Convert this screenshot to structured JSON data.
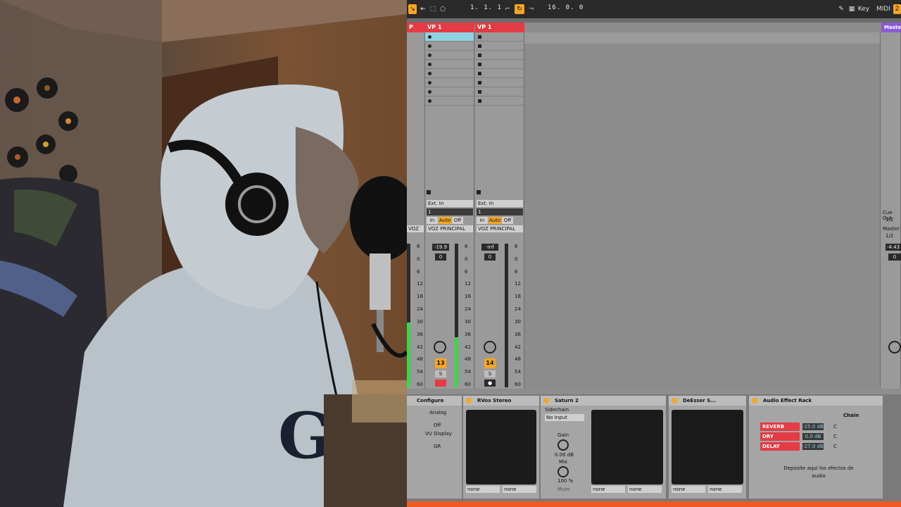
{
  "transport": {
    "position": "1.   1.   1",
    "end_position": "16.   0.   0",
    "key_label": "Key",
    "midi_label": "MIDI"
  },
  "tracks": [
    {
      "name": "VP 1",
      "input_type": "Ext. In",
      "input_channel": "1",
      "monitor": [
        "In",
        "Auto",
        "Off"
      ],
      "output": "VOZ PRINCIPAL",
      "volume": "-19.9",
      "pan": "0",
      "number": "13",
      "solo_label": "S",
      "armed": true,
      "meter_level": 0.35
    },
    {
      "name": "VP 1",
      "input_type": "Ext. In",
      "input_channel": "1",
      "monitor": [
        "In",
        "Auto",
        "Off"
      ],
      "output": "VOZ PRINCIPAL",
      "volume": "-inf",
      "pan": "0",
      "number": "14",
      "solo_label": "S",
      "armed": false,
      "meter_level": 0.0
    }
  ],
  "partial_track": {
    "name": "P",
    "output": "VOZ PRINCIPAL",
    "meter_level": 0.45
  },
  "meter_scale": [
    "6",
    "0",
    "6",
    "12",
    "18",
    "24",
    "30",
    "36",
    "42",
    "48",
    "54",
    "60"
  ],
  "master": {
    "name": "Master",
    "cue_out_label": "Cue Out",
    "cue_out_value": "1/2",
    "master_out_label": "Master",
    "master_out_value": "1/2",
    "volume": "-4.43",
    "pan": "0"
  },
  "devices": {
    "configure": {
      "label": "Configure",
      "items": [
        "Analog",
        "Off",
        "VU Display",
        "GR"
      ]
    },
    "rvox": {
      "title": "RVox Stereo",
      "sc_left": "none",
      "sc_right": "none"
    },
    "saturn": {
      "title": "Saturn 2",
      "sidechain_label": "Sidechain",
      "sidechain_value": "No Input",
      "gain_label": "Gain",
      "gain_value": "0.00 dB",
      "mix_label": "Mix",
      "mix_value": "100 %",
      "mute_label": "Mute"
    },
    "saturn_sc": {
      "left": "none",
      "right": "none"
    },
    "deesser": {
      "title": "DeEsser S...",
      "sc_left": "none",
      "sc_right": "none"
    },
    "rack": {
      "title": "Audio Effect Rack",
      "chain_label": "Chain",
      "chains": [
        {
          "name": "REVERB",
          "value": "-25.0 dB",
          "pan": "C"
        },
        {
          "name": "DRY",
          "value": "0.0 dB",
          "pan": "C"
        },
        {
          "name": "DELAY",
          "value": "-27.0 dB",
          "pan": "C"
        }
      ],
      "drop_hint": "Deposite aquí los efectos de audio"
    }
  },
  "colors": {
    "accent": "#f5a623",
    "track_red": "#e43b44",
    "master_purple": "#8a5ad4",
    "meter_green": "#39d74a"
  }
}
